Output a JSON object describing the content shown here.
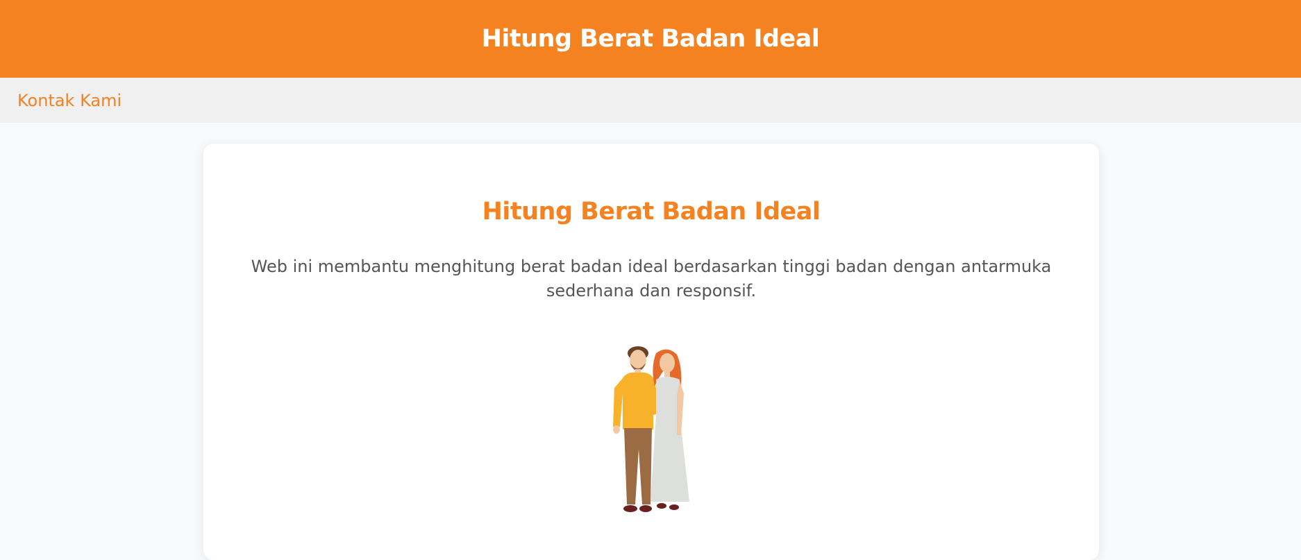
{
  "header": {
    "title": "Hitung Berat Badan Ideal",
    "background_color": "#f58220"
  },
  "nav": {
    "contact_label": "Kontak Kami"
  },
  "main": {
    "title": "Hitung Berat Badan Ideal",
    "description": "Web ini membantu menghitung berat badan ideal berdasarkan tinggi badan dengan antarmuka sederhana dan responsif.",
    "illustration": "couple-illustration"
  },
  "colors": {
    "accent": "#f58220",
    "nav_background": "#f0f0f0",
    "page_background": "#f8f9fa",
    "text": "#555555"
  }
}
